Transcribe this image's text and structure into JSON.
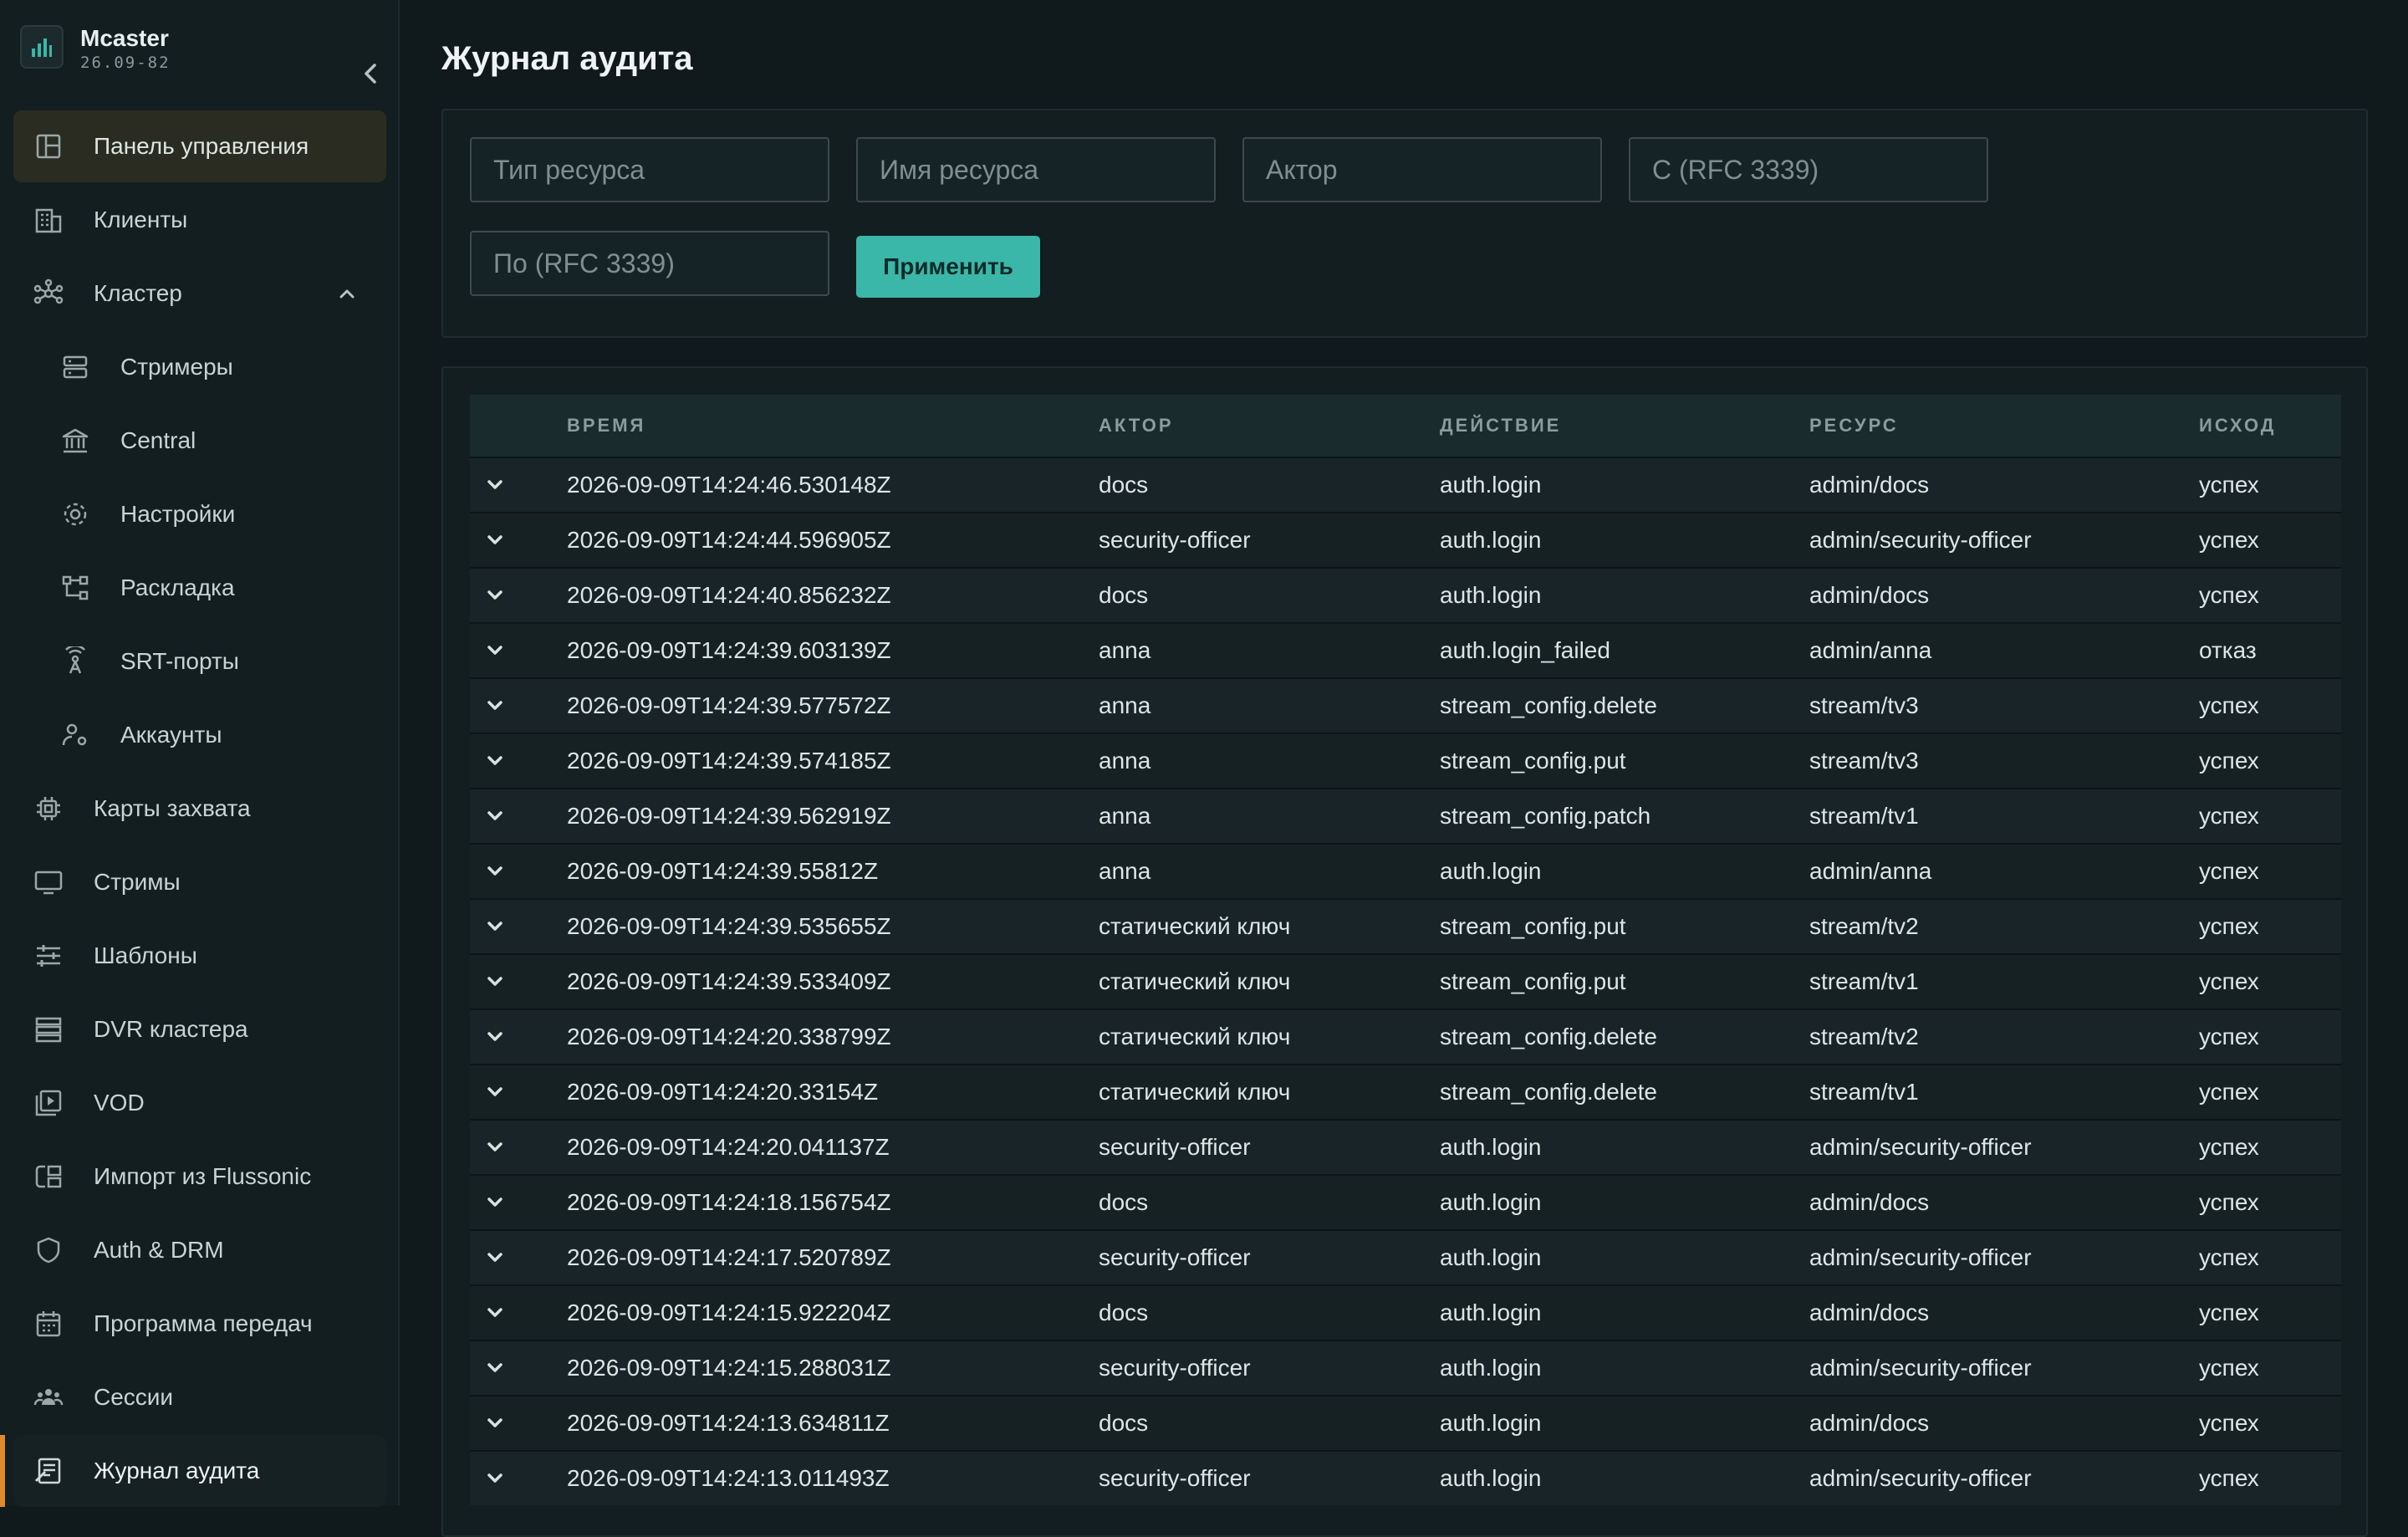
{
  "brand": {
    "name": "Mcaster",
    "version": "26.09-82"
  },
  "sidebar": {
    "items": [
      {
        "label": "Панель управления",
        "icon": "dashboard-icon"
      },
      {
        "label": "Клиенты",
        "icon": "building-icon"
      },
      {
        "label": "Кластер",
        "icon": "cluster-icon"
      },
      {
        "label": "Стримеры",
        "icon": "server-icon"
      },
      {
        "label": "Central",
        "icon": "bank-icon"
      },
      {
        "label": "Настройки",
        "icon": "gear-icon"
      },
      {
        "label": "Раскладка",
        "icon": "layout-icon"
      },
      {
        "label": "SRT-порты",
        "icon": "antenna-icon"
      },
      {
        "label": "Аккаунты",
        "icon": "user-gear-icon"
      },
      {
        "label": "Карты захвата",
        "icon": "chip-icon"
      },
      {
        "label": "Стримы",
        "icon": "monitor-icon"
      },
      {
        "label": "Шаблоны",
        "icon": "sliders-icon"
      },
      {
        "label": "DVR кластера",
        "icon": "storage-icon"
      },
      {
        "label": "VOD",
        "icon": "video-library-icon"
      },
      {
        "label": "Импорт из Flussonic",
        "icon": "import-icon"
      },
      {
        "label": "Auth & DRM",
        "icon": "shield-icon"
      },
      {
        "label": "Программа передач",
        "icon": "calendar-icon"
      },
      {
        "label": "Сессии",
        "icon": "users-icon"
      },
      {
        "label": "Журнал аудита",
        "icon": "audit-log-icon"
      }
    ]
  },
  "page": {
    "title": "Журнал аудита"
  },
  "filters": {
    "resource_type": "Тип ресурса",
    "resource_name": "Имя ресурса",
    "actor": "Актор",
    "from": "С (RFC 3339)",
    "to": "По (RFC 3339)",
    "apply": "Применить"
  },
  "table": {
    "headers": {
      "time": "ВРЕМЯ",
      "actor": "АКТОР",
      "action": "ДЕЙСТВИЕ",
      "resource": "РЕСУРС",
      "outcome": "ИСХОД"
    },
    "rows": [
      {
        "time": "2026-09-09T14:24:46.530148Z",
        "actor": "docs",
        "action": "auth.login",
        "resource": "admin/docs",
        "outcome": "успех"
      },
      {
        "time": "2026-09-09T14:24:44.596905Z",
        "actor": "security-officer",
        "action": "auth.login",
        "resource": "admin/security-officer",
        "outcome": "успех"
      },
      {
        "time": "2026-09-09T14:24:40.856232Z",
        "actor": "docs",
        "action": "auth.login",
        "resource": "admin/docs",
        "outcome": "успех"
      },
      {
        "time": "2026-09-09T14:24:39.603139Z",
        "actor": "anna",
        "action": "auth.login_failed",
        "resource": "admin/anna",
        "outcome": "отказ"
      },
      {
        "time": "2026-09-09T14:24:39.577572Z",
        "actor": "anna",
        "action": "stream_config.delete",
        "resource": "stream/tv3",
        "outcome": "успех"
      },
      {
        "time": "2026-09-09T14:24:39.574185Z",
        "actor": "anna",
        "action": "stream_config.put",
        "resource": "stream/tv3",
        "outcome": "успех"
      },
      {
        "time": "2026-09-09T14:24:39.562919Z",
        "actor": "anna",
        "action": "stream_config.patch",
        "resource": "stream/tv1",
        "outcome": "успех"
      },
      {
        "time": "2026-09-09T14:24:39.55812Z",
        "actor": "anna",
        "action": "auth.login",
        "resource": "admin/anna",
        "outcome": "успех"
      },
      {
        "time": "2026-09-09T14:24:39.535655Z",
        "actor": "статический ключ",
        "action": "stream_config.put",
        "resource": "stream/tv2",
        "outcome": "успех"
      },
      {
        "time": "2026-09-09T14:24:39.533409Z",
        "actor": "статический ключ",
        "action": "stream_config.put",
        "resource": "stream/tv1",
        "outcome": "успех"
      },
      {
        "time": "2026-09-09T14:24:20.338799Z",
        "actor": "статический ключ",
        "action": "stream_config.delete",
        "resource": "stream/tv2",
        "outcome": "успех"
      },
      {
        "time": "2026-09-09T14:24:20.33154Z",
        "actor": "статический ключ",
        "action": "stream_config.delete",
        "resource": "stream/tv1",
        "outcome": "успех"
      },
      {
        "time": "2026-09-09T14:24:20.041137Z",
        "actor": "security-officer",
        "action": "auth.login",
        "resource": "admin/security-officer",
        "outcome": "успех"
      },
      {
        "time": "2026-09-09T14:24:18.156754Z",
        "actor": "docs",
        "action": "auth.login",
        "resource": "admin/docs",
        "outcome": "успех"
      },
      {
        "time": "2026-09-09T14:24:17.520789Z",
        "actor": "security-officer",
        "action": "auth.login",
        "resource": "admin/security-officer",
        "outcome": "успех"
      },
      {
        "time": "2026-09-09T14:24:15.922204Z",
        "actor": "docs",
        "action": "auth.login",
        "resource": "admin/docs",
        "outcome": "успех"
      },
      {
        "time": "2026-09-09T14:24:15.288031Z",
        "actor": "security-officer",
        "action": "auth.login",
        "resource": "admin/security-officer",
        "outcome": "успех"
      },
      {
        "time": "2026-09-09T14:24:13.634811Z",
        "actor": "docs",
        "action": "auth.login",
        "resource": "admin/docs",
        "outcome": "успех"
      },
      {
        "time": "2026-09-09T14:24:13.011493Z",
        "actor": "security-officer",
        "action": "auth.login",
        "resource": "admin/security-officer",
        "outcome": "успех"
      }
    ]
  }
}
